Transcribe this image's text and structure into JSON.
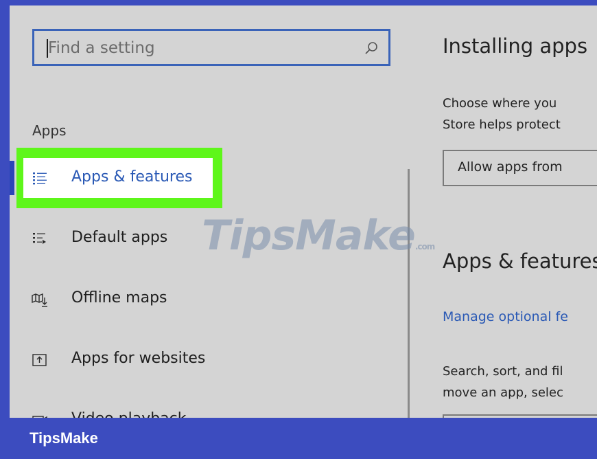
{
  "search": {
    "placeholder": "Find a setting",
    "icon": "search-icon"
  },
  "sidebar": {
    "section_label": "Apps",
    "items": [
      {
        "label": "Apps & features",
        "icon": "list-icon",
        "active": true
      },
      {
        "label": "Default apps",
        "icon": "list-default-icon",
        "active": false
      },
      {
        "label": "Offline maps",
        "icon": "map-download-icon",
        "active": false
      },
      {
        "label": "Apps for websites",
        "icon": "open-in-app-icon",
        "active": false
      },
      {
        "label": "Video playback",
        "icon": "video-icon",
        "active": false
      }
    ]
  },
  "main": {
    "heading1": "Installing apps",
    "desc1_line1": "Choose where you",
    "desc1_line2": "Store helps protect",
    "dropdown_value": "Allow apps from",
    "heading2": "Apps & features",
    "link": "Manage optional fe",
    "desc2_line1": "Search, sort, and fil",
    "desc2_line2": "move an app, selec"
  },
  "watermark": {
    "main": "TipsMake",
    "suffix": ".com"
  },
  "brand": {
    "label": "TipsMake"
  },
  "colors": {
    "accent": "#2a59b5",
    "highlight": "#5ef61a",
    "frame": "#3c4cbf",
    "background": "#d4d4d4"
  }
}
